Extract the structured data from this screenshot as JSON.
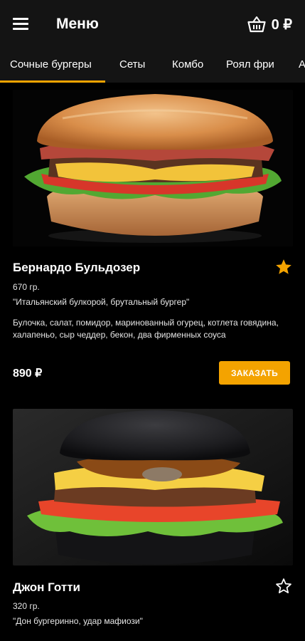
{
  "appbar": {
    "title": "Меню",
    "cart_total": "0 ₽"
  },
  "tabs": [
    {
      "label": "Сочные бургеры",
      "active": true
    },
    {
      "label": "Сеты"
    },
    {
      "label": "Комбо"
    },
    {
      "label": "Роял фри"
    },
    {
      "label": "А"
    }
  ],
  "colors": {
    "accent": "#f4a300",
    "bar": "#141414",
    "background": "#000000"
  },
  "products": [
    {
      "name": "Бернардо Бульдозер",
      "weight": "670 гр.",
      "tagline": "\"Итальянский булкорой, брутальный бургер\"",
      "description": "Булочка, салат, помидор, маринованный огурец, котлета говядина, халапеньо, сыр чеддер, бекон, два фирменных соуса",
      "price": "890 ₽",
      "order_label": "ЗАКАЗАТЬ",
      "favorite": true,
      "icon": "star-filled-icon"
    },
    {
      "name": "Джон Готти",
      "weight": "320 гр.",
      "tagline": "\"Дон бургеринно, удар мафиози\"",
      "favorite": false,
      "icon": "star-outline-icon"
    }
  ]
}
